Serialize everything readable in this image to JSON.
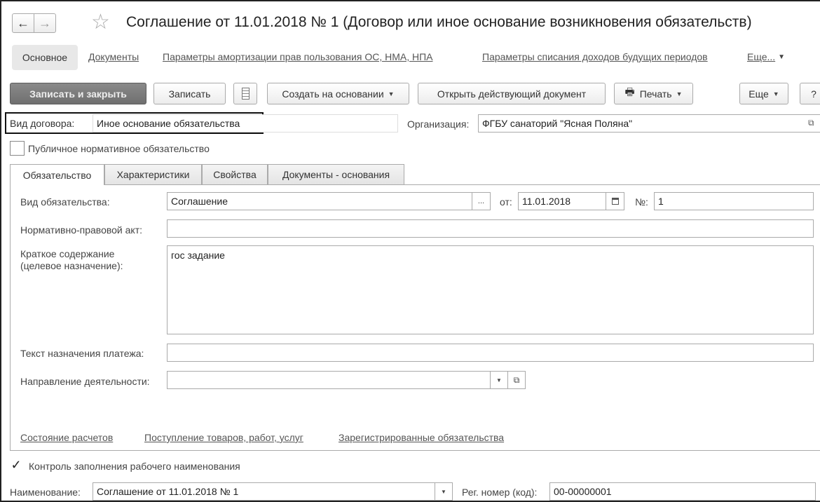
{
  "window": {
    "title": "Соглашение от 11.01.2018 № 1 (Договор или иное основание возникновения обязательств)"
  },
  "nav_tabs": {
    "main": "Основное",
    "documents": "Документы",
    "amortization": "Параметры амортизации прав пользования ОС, НМА, НПА",
    "deferred": "Параметры списания доходов будущих периодов",
    "more": "Еще..."
  },
  "toolbar": {
    "save_close": "Записать и закрыть",
    "save": "Записать",
    "create_based": "Создать на основании",
    "open_current": "Открыть действующий документ",
    "print": "Печать",
    "more": "Еще",
    "help": "?"
  },
  "header_fields": {
    "contract_type_label": "Вид договора:",
    "contract_type_value": "Иное основание обязательства",
    "organization_label": "Организация:",
    "organization_value": "ФГБУ санаторий \"Ясная Поляна\"",
    "public_obligation_label": "Публичное нормативное обязательство"
  },
  "tabs": [
    "Обязательство",
    "Характеристики",
    "Свойства",
    "Документы - основания"
  ],
  "obligation": {
    "kind_label": "Вид обязательства:",
    "kind_value": "Соглашение",
    "from_label": "от:",
    "date_value": "11.01.2018",
    "number_label": "№:",
    "number_value": "1",
    "act_label": "Нормативно-правовой акт:",
    "act_value": "",
    "summary_label": "Краткое содержание (целевое назначение):",
    "summary_value": "гос задание",
    "payment_text_label": "Текст назначения платежа:",
    "payment_text_value": "",
    "direction_label": "Направление деятельности:",
    "direction_value": ""
  },
  "bottom_links": {
    "settlements": "Состояние расчетов",
    "receipts": "Поступление товаров, работ, услуг",
    "registered": "Зарегистрированные обязательства"
  },
  "footer": {
    "control_label": "Контроль заполнения рабочего наименования",
    "control_checked": true,
    "name_label": "Наименование:",
    "name_value": "Соглашение от 11.01.2018 № 1",
    "reg_label": "Рег. номер (код):",
    "reg_value": "00-00000001"
  }
}
